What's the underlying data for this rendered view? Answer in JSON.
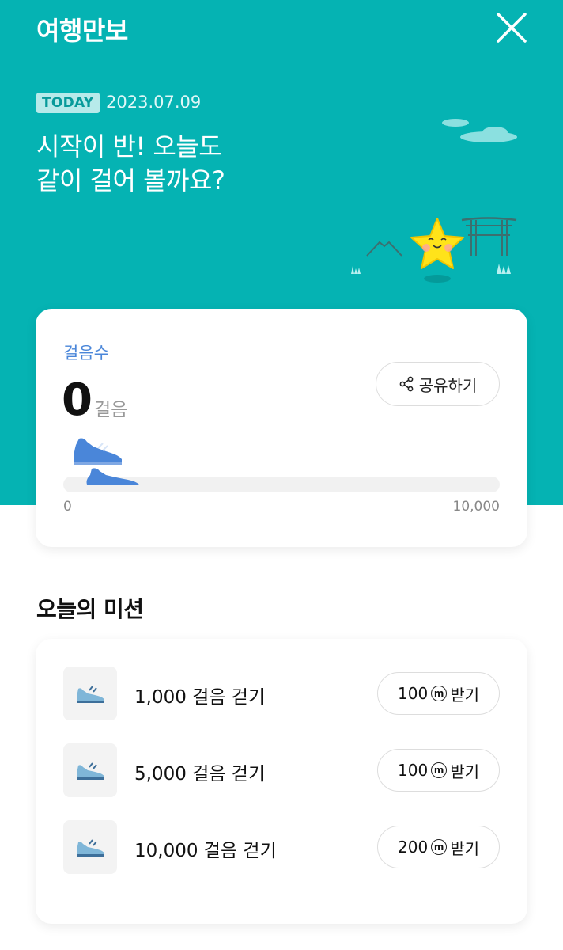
{
  "header": {
    "title": "여행만보",
    "close_icon": "close-icon"
  },
  "today": {
    "badge": "TODAY",
    "date": "2023.07.09",
    "headline_line1": "시작이 반! 오늘도",
    "headline_line2": "같이 걸어 볼까요?"
  },
  "steps": {
    "label": "걸음수",
    "count": "0",
    "unit": "걸음",
    "share_label": "공유하기",
    "share_icon": "share-icon",
    "range_min": "0",
    "range_max": "10,000",
    "progress_fraction": 0
  },
  "missions": {
    "title": "오늘의 미션",
    "coin_symbol": "ⓜ",
    "claim_label": "받기",
    "items": [
      {
        "text": "1,000 걸음 걷기",
        "reward": "100",
        "icon": "sneaker-icon"
      },
      {
        "text": "5,000 걸음 걷기",
        "reward": "100",
        "icon": "sneaker-icon"
      },
      {
        "text": "10,000 걸음 걷기",
        "reward": "200",
        "icon": "sneaker-icon"
      }
    ]
  },
  "colors": {
    "hero_bg": "#05b3b3",
    "accent_blue": "#4a86d9",
    "star_yellow": "#ffe31a"
  }
}
